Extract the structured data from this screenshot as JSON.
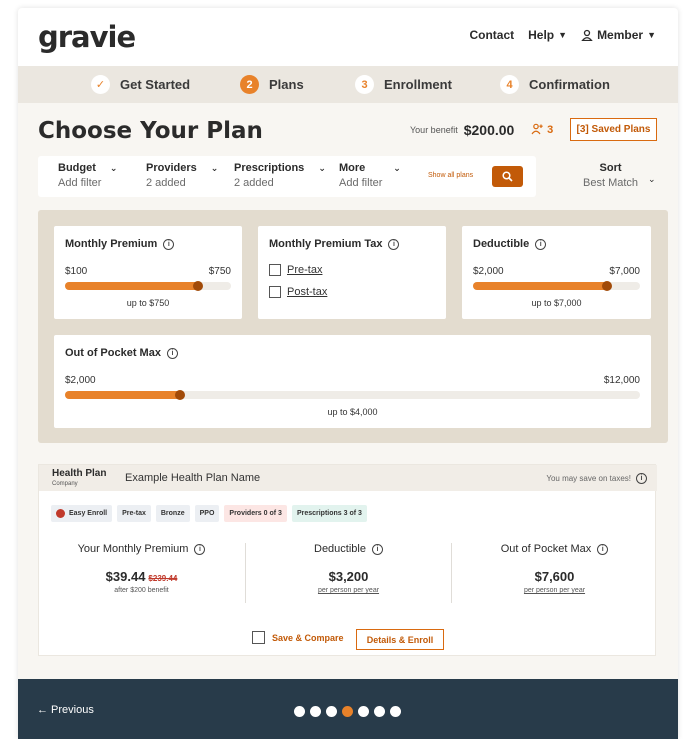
{
  "header": {
    "logo": "gravie",
    "nav": {
      "contact": "Contact",
      "help": "Help",
      "member": "Member"
    }
  },
  "steps": [
    {
      "marker": "✓",
      "label": "Get Started",
      "state": "done"
    },
    {
      "marker": "2",
      "label": "Plans",
      "state": "active"
    },
    {
      "marker": "3",
      "label": "Enrollment",
      "state": "todo"
    },
    {
      "marker": "4",
      "label": "Confirmation",
      "state": "todo"
    }
  ],
  "page": {
    "title": "Choose Your Plan",
    "benefit_label": "Your benefit",
    "benefit_value": "$200.00",
    "people_count": "3",
    "saved_plans": "[3] Saved Plans"
  },
  "filters": {
    "items": [
      {
        "label": "Budget",
        "sub": "Add filter"
      },
      {
        "label": "Providers",
        "sub": "2 added"
      },
      {
        "label": "Prescriptions",
        "sub": "2 added"
      },
      {
        "label": "More",
        "sub": "Add filter"
      }
    ],
    "show_all": "Show all plans",
    "sort_label": "Sort",
    "sort_value": "Best Match"
  },
  "panel": {
    "premium": {
      "title": "Monthly Premium",
      "min": "$100",
      "max": "$750",
      "caption": "up to $750",
      "fraction": 0.8
    },
    "tax": {
      "title": "Monthly Premium Tax",
      "options": [
        "Pre-tax",
        "Post-tax"
      ]
    },
    "deductible": {
      "title": "Deductible",
      "min": "$2,000",
      "max": "$7,000",
      "caption": "up to $7,000",
      "fraction": 0.8
    },
    "oop": {
      "title": "Out of Pocket Max",
      "min": "$2,000",
      "max": "$12,000",
      "caption": "up to $4,000",
      "fraction": 0.2
    }
  },
  "plan": {
    "head_title": "Health Plan",
    "head_sub": "Company",
    "name": "Example Health Plan Name",
    "save_note": "You may save on taxes!",
    "tags": [
      {
        "label": "Easy Enroll",
        "kind": "easy"
      },
      {
        "label": "Pre-tax",
        "kind": "plain"
      },
      {
        "label": "Bronze",
        "kind": "plain"
      },
      {
        "label": "PPO",
        "kind": "plain"
      },
      {
        "label": "Providers 0 of 3",
        "kind": "red"
      },
      {
        "label": "Prescriptions 3 of 3",
        "kind": "green"
      }
    ],
    "premium": {
      "label": "Your Monthly Premium",
      "value": "$39.44",
      "strike": "$239.44",
      "sub": "after $200 benefit"
    },
    "deductible": {
      "label": "Deductible",
      "value": "$3,200",
      "sub": "per person per year"
    },
    "oop": {
      "label": "Out of Pocket Max",
      "value": "$7,600",
      "sub": "per person per year"
    },
    "compare": "Save & Compare",
    "enroll": "Details & Enroll"
  },
  "footer": {
    "previous": "← Previous",
    "dots_total": 7,
    "dots_active": 4
  },
  "colors": {
    "accent": "#e8822a",
    "accent_dark": "#c25a08",
    "footer": "#283b4a",
    "panel": "#e3dccf"
  }
}
